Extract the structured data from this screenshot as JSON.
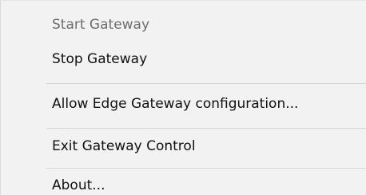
{
  "context_menu": {
    "items": [
      {
        "label": "Start Gateway",
        "enabled": false
      },
      {
        "label": "Stop Gateway",
        "enabled": true
      },
      {
        "label": "Allow Edge Gateway configuration...",
        "enabled": true
      },
      {
        "label": "Exit Gateway Control",
        "enabled": true
      },
      {
        "label": "About...",
        "enabled": true
      }
    ]
  },
  "colors": {
    "menu_background": "#f2f2f2",
    "text": "#111111",
    "disabled_text": "#6d6d6d",
    "separator": "#d6d6d6"
  }
}
